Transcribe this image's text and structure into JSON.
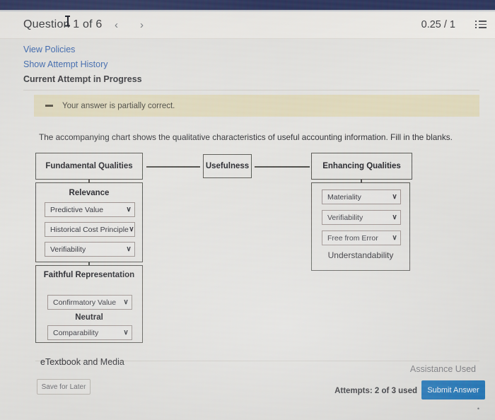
{
  "header": {
    "question_title": "Question 1 of 6",
    "prev_label": "‹",
    "next_label": "›",
    "score": "0.25 / 1"
  },
  "links": {
    "view_policies": "View Policies",
    "show_attempt_history": "Show Attempt History",
    "current_attempt": "Current Attempt in Progress"
  },
  "banner": {
    "text": "Your answer is partially correct."
  },
  "prompt": "The accompanying chart shows the qualitative characteristics of useful accounting information. Fill in the blanks.",
  "diagram": {
    "fundamental_qualities": "Fundamental Qualities",
    "usefulness": "Usefulness",
    "enhancing_qualities": "Enhancing Qualities",
    "relevance_label": "Relevance",
    "faithful_label": "Faithful Representation",
    "neutral_label": "Neutral",
    "understandability_label": "Understandability",
    "relevance_dropdowns": [
      {
        "value": "Predictive Value"
      },
      {
        "value": "Historical Cost Principle"
      },
      {
        "value": "Verifiability"
      }
    ],
    "faithful_dropdowns": [
      {
        "value": "Confirmatory Value"
      },
      {
        "value": "Comparability"
      }
    ],
    "enhancing_dropdowns": [
      {
        "value": "Materiality"
      },
      {
        "value": "Verifiability"
      },
      {
        "value": "Free from Error"
      }
    ],
    "chevron": "∨"
  },
  "footer": {
    "etextbook": "eTextbook and Media",
    "assistance_used": "Assistance Used",
    "save_for_later": "Save for Later",
    "attempts": "Attempts: 2 of 3 used",
    "submit_answer": "Submit Answer",
    "scroll_marker": "•"
  },
  "colors": {
    "topbar": "#2b3358",
    "link": "#2f5ca8",
    "banner_bg": "#ddd6b8",
    "submit_bg": "#1b71b8"
  }
}
